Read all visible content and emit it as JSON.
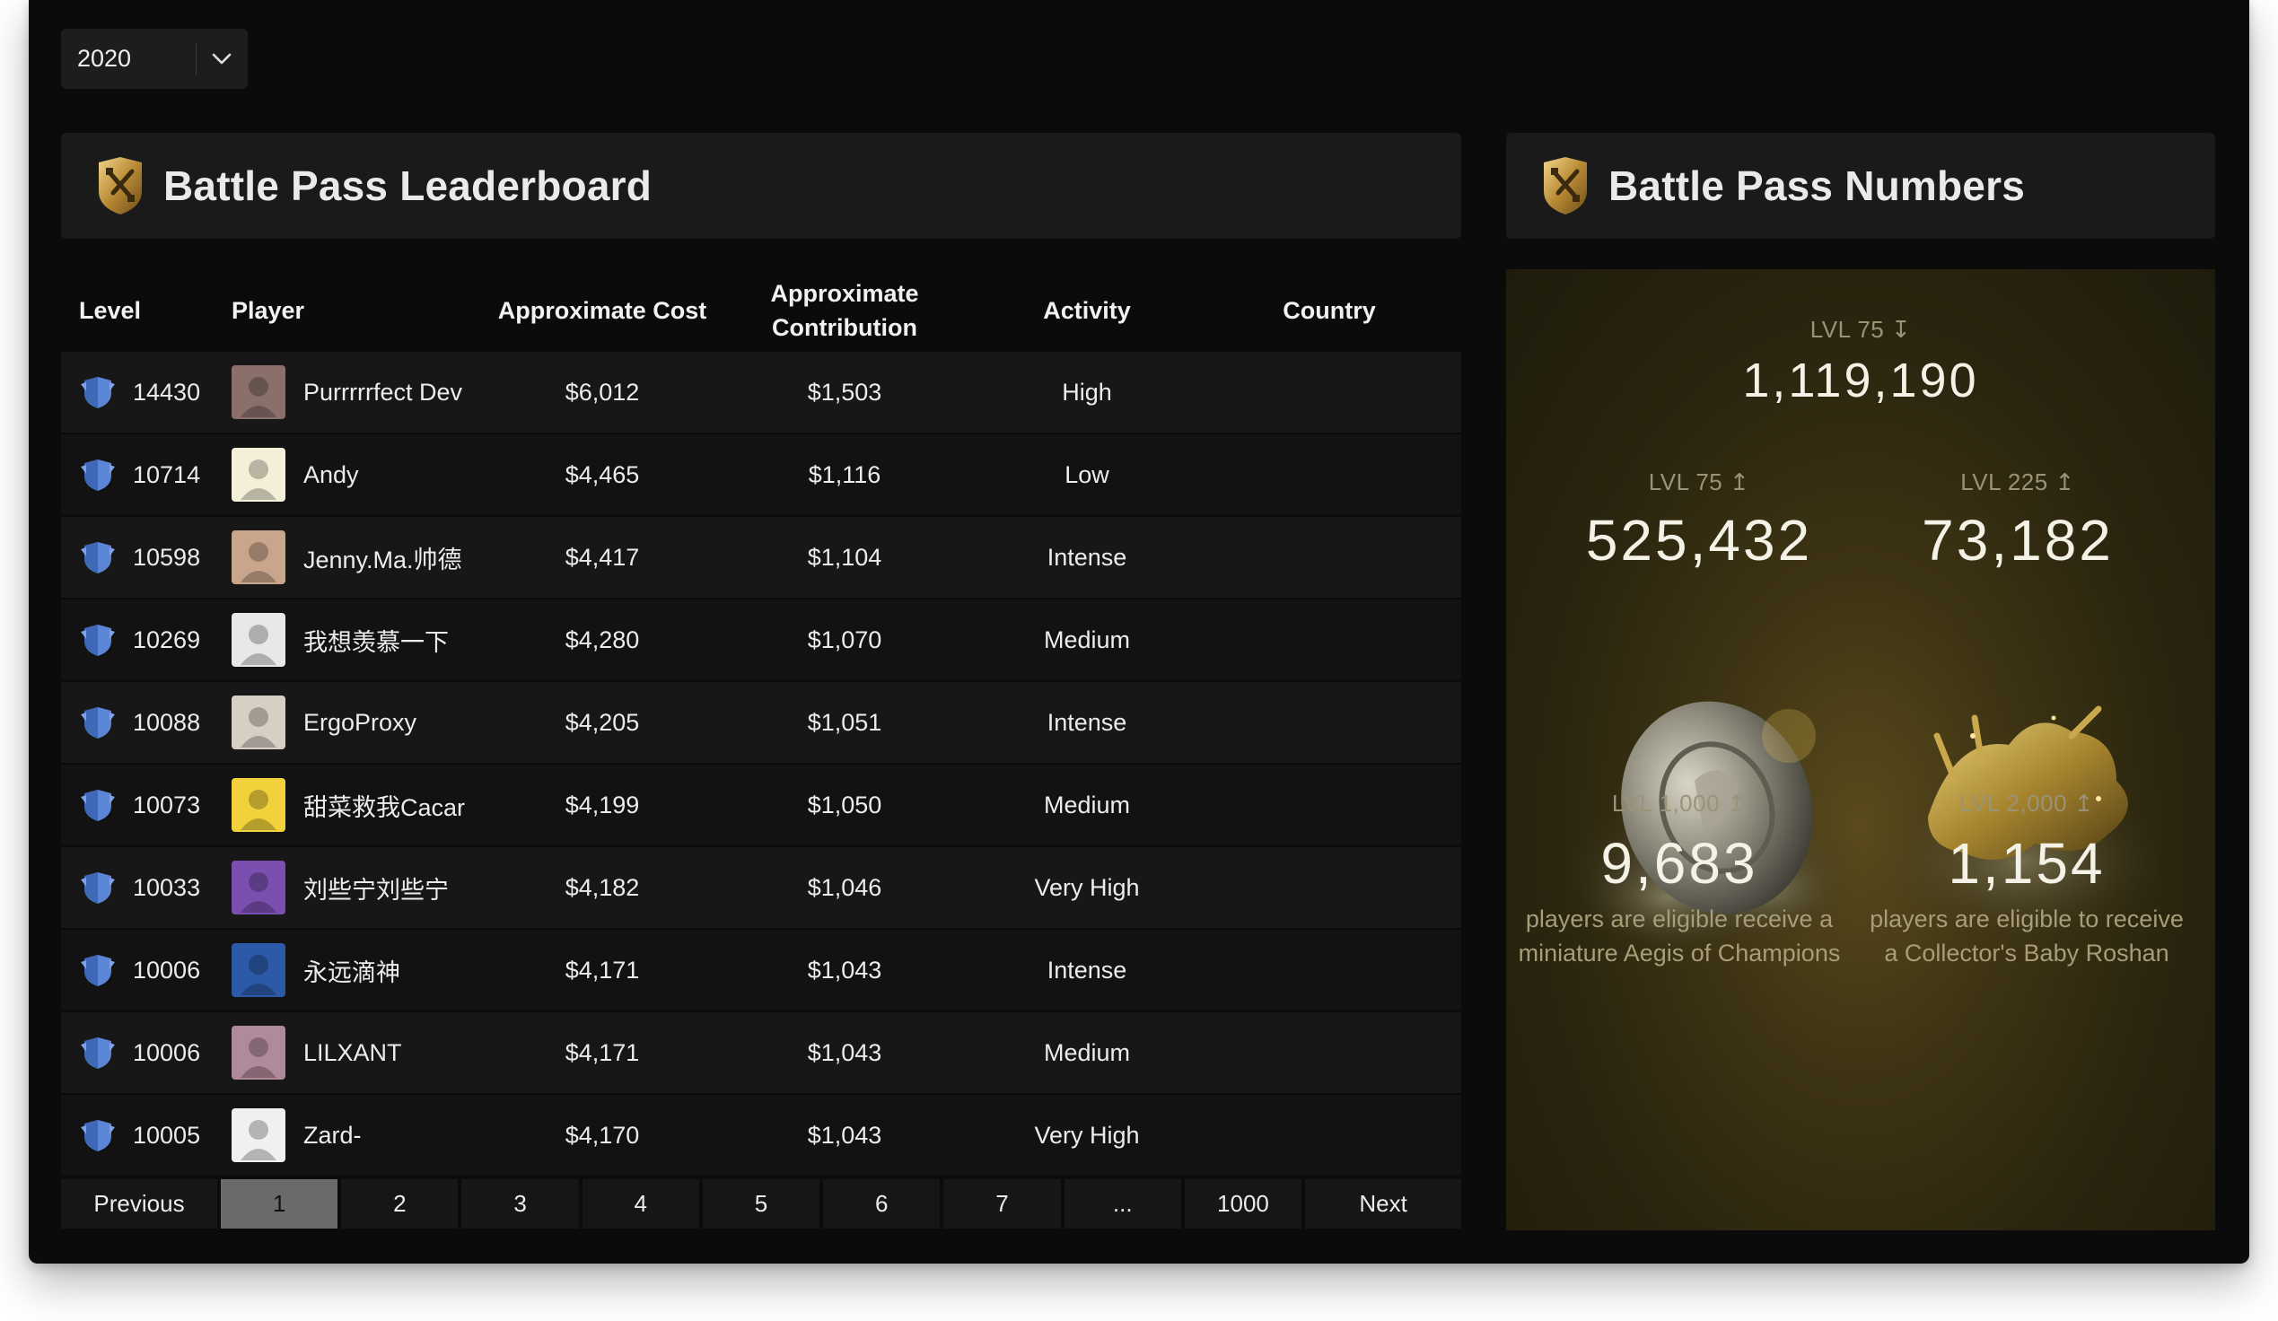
{
  "year_select": {
    "value": "2020"
  },
  "leaderboard": {
    "title": "Battle Pass Leaderboard",
    "columns": {
      "level": "Level",
      "player": "Player",
      "cost": "Approximate Cost",
      "contribution_line1": "Approximate",
      "contribution_line2": "Contribution",
      "activity": "Activity",
      "country": "Country"
    },
    "rows": [
      {
        "level": "14430",
        "player": "Purrrrrfect Dev",
        "cost": "$6,012",
        "contribution": "$1,503",
        "activity": "High",
        "country": ""
      },
      {
        "level": "10714",
        "player": "Andy",
        "cost": "$4,465",
        "contribution": "$1,116",
        "activity": "Low",
        "country": ""
      },
      {
        "level": "10598",
        "player": "Jenny.Ma.帅德",
        "cost": "$4,417",
        "contribution": "$1,104",
        "activity": "Intense",
        "country": ""
      },
      {
        "level": "10269",
        "player": "我想羡慕一下",
        "cost": "$4,280",
        "contribution": "$1,070",
        "activity": "Medium",
        "country": ""
      },
      {
        "level": "10088",
        "player": "ErgoProxy",
        "cost": "$4,205",
        "contribution": "$1,051",
        "activity": "Intense",
        "country": ""
      },
      {
        "level": "10073",
        "player": "甜菜救我Cacar",
        "cost": "$4,199",
        "contribution": "$1,050",
        "activity": "Medium",
        "country": ""
      },
      {
        "level": "10033",
        "player": "刘些宁刘些宁",
        "cost": "$4,182",
        "contribution": "$1,046",
        "activity": "Very High",
        "country": ""
      },
      {
        "level": "10006",
        "player": "永远滴神",
        "cost": "$4,171",
        "contribution": "$1,043",
        "activity": "Intense",
        "country": ""
      },
      {
        "level": "10006",
        "player": "LILXANT",
        "cost": "$4,171",
        "contribution": "$1,043",
        "activity": "Medium",
        "country": ""
      },
      {
        "level": "10005",
        "player": "Zard-",
        "cost": "$4,170",
        "contribution": "$1,043",
        "activity": "Very High",
        "country": ""
      }
    ]
  },
  "pagination": {
    "previous": "Previous",
    "pages": [
      "1",
      "2",
      "3",
      "4",
      "5",
      "6",
      "7",
      "...",
      "1000"
    ],
    "active": "1",
    "next": "Next"
  },
  "numbers": {
    "title": "Battle Pass Numbers",
    "below_75": {
      "label": "LVL 75 ↧",
      "value": "1,119,190"
    },
    "above_75": {
      "label": "LVL 75 ↥",
      "value": "525,432"
    },
    "above_225": {
      "label": "LVL 225 ↥",
      "value": "73,182"
    },
    "above_1000": {
      "label": "LVL 1,000 ↥",
      "value": "9,683",
      "desc_line1": "players are eligible receive a",
      "desc_line2": "miniature Aegis of Champions"
    },
    "above_2000": {
      "label": "LVL 2,000 ↥",
      "value": "1,154",
      "desc_line1": "players are eligible to receive",
      "desc_line2": "a Collector's Baby Roshan"
    }
  },
  "colors": {
    "window_bg": "#0b0b0b",
    "panel_bg": "#1a1a1a",
    "gold": "#c9a54a",
    "badge_blue": "#5b86d6"
  }
}
